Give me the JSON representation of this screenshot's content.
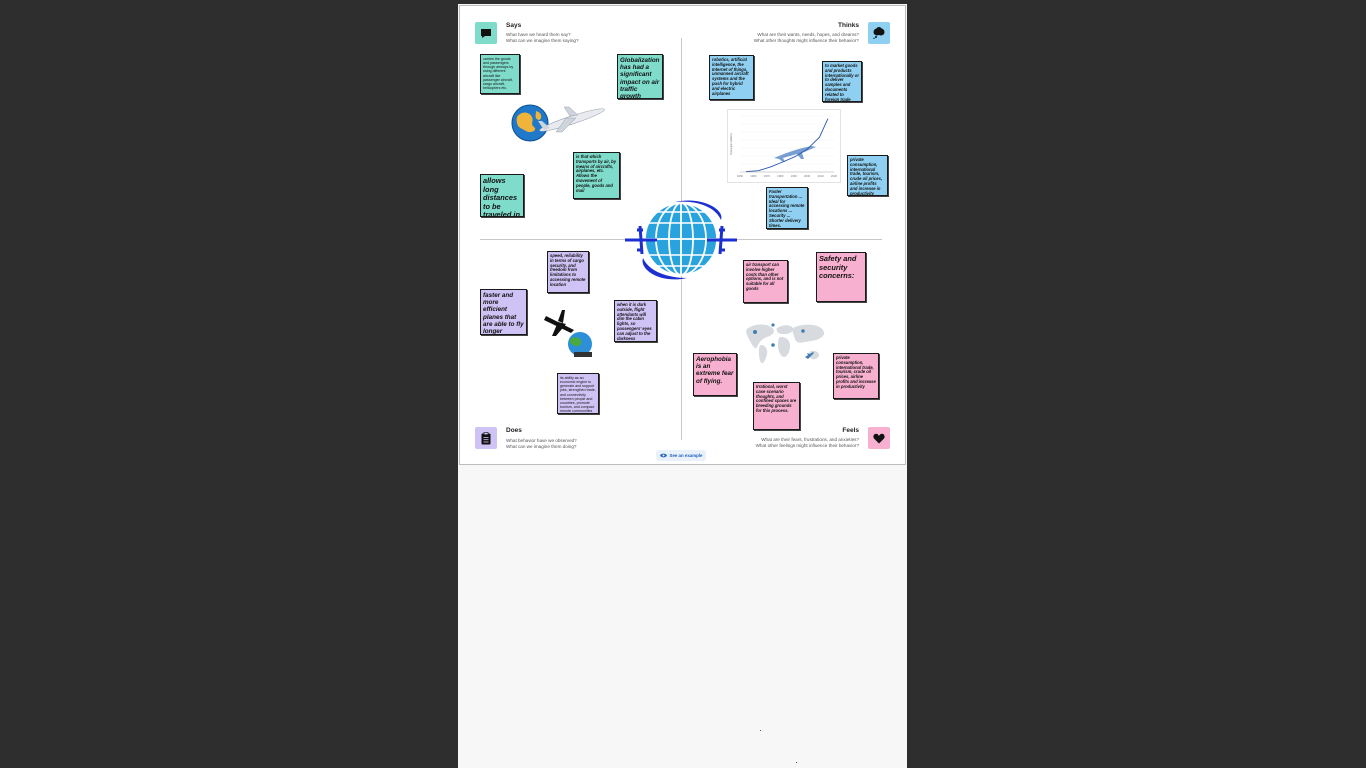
{
  "quadrants": {
    "says": {
      "title": "Says",
      "subtitle_1": "What have we heard them say?",
      "subtitle_2": "What can we imagine them saying?",
      "icon": "speech-bubble-icon",
      "color": "#7fdccb"
    },
    "thinks": {
      "title": "Thinks",
      "subtitle_1": "What are their wants, needs, hopes, and dreams?",
      "subtitle_2": "What other thoughts might influence their behavior?",
      "icon": "thought-cloud-icon",
      "color": "#8fd0f2"
    },
    "does": {
      "title": "Does",
      "subtitle_1": "What behavior have we observed?",
      "subtitle_2": "What can we imagine them doing?",
      "icon": "clipboard-icon",
      "color": "#cfc3f5"
    },
    "feels": {
      "title": "Feels",
      "subtitle_1": "What are their fears, frustrations, and anxieties?",
      "subtitle_2": "What other feelings might influence their behavior?",
      "icon": "heart-icon",
      "color": "#f7b0cf"
    }
  },
  "notes": {
    "says_1": "carries the goods and passengers through airways by using different aircraft like passenger aircraft, cargo aircraft, helicopters etc.",
    "says_2": "Globalization has had a significant impact on air traffic growth",
    "says_3": "is that which transports by air, by means of aircrafts, airplanes, etc. Allows the movement of people, goods and mail",
    "says_4": "allows long distances to be traveled in less time",
    "thinks_1": "robotics, artificial intelligence, the Internet of things, unmanned aircraft systems and the push for hybrid and electric airplanes",
    "thinks_2": "to market goods and products internationally or to deliver samples and documents related to foreign trade operations.",
    "thinks_3": "private consumption, international trade, tourism, crude oil prices, airline profits and increase in productivity",
    "thinks_4": "Faster transportation ... Ideal for accessing remote locations ... Security ... Shorter delivery times.",
    "does_1": "speed, reliability in terms of cargo security, and freedom from limitations to accessing remote location",
    "does_2": "faster and more efficient planes that are able to fly longer distances",
    "does_3": "when it is dark outside, flight attendants will dim the cabin lights, so passengers' eyes can adjust to the darkness",
    "does_4": "its ability as an economic engine to generate and support jobs, strengthen trade, and connectivity between people and countries, promote tourism, and compact remote communities",
    "feels_1": "air transport can involve higher costs than other options, and is not suitable for all goods",
    "feels_2": "Safety and security concerns:",
    "feels_3": "Aerophobia is an extreme fear of flying.",
    "feels_4": "private consumption, international trade, tourism, crude oil prices, airline profits and increase in productivity",
    "feels_5": "Irrational, worst case scenario thoughts, and confined spaces are breeding grounds for this process."
  },
  "chart_data": {
    "type": "line",
    "x": [
      1950,
      1960,
      1970,
      1980,
      1990,
      2000,
      2010,
      2017
    ],
    "x_tick_labels": [
      "1950",
      "1960",
      "1970",
      "1980",
      "1990",
      "2000",
      "2010",
      "2020"
    ],
    "values": [
      0.03,
      0.1,
      0.38,
      0.75,
      1.15,
      1.7,
      2.6,
      4.0
    ],
    "ylabel": "Passengers (billions)"
  },
  "example_button": {
    "label": "See an example",
    "icon": "eye-icon"
  },
  "colors": {
    "teal": "#7fdccb",
    "blue": "#8fd0f2",
    "lavender": "#cfc3f5",
    "pink": "#f7b0cf",
    "globe": "#29a3dd",
    "plane": "#1c2fd0"
  }
}
